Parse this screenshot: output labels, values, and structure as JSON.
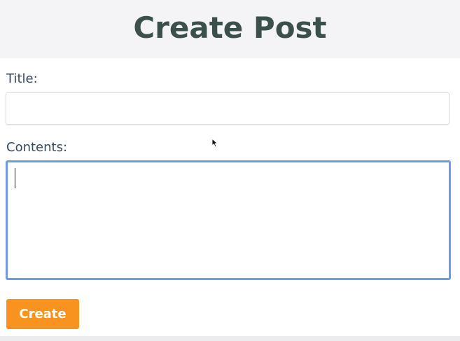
{
  "header": {
    "title": "Create Post"
  },
  "form": {
    "title_label": "Title:",
    "title_value": "",
    "contents_label": "Contents:",
    "contents_value": "",
    "submit_label": "Create"
  },
  "colors": {
    "title_text": "#3b504a",
    "label_text": "#34495e",
    "focus_border": "#6f9ae6",
    "button_bg": "#f7931e"
  },
  "icons": {
    "cursor": "mouse-pointer-icon"
  }
}
